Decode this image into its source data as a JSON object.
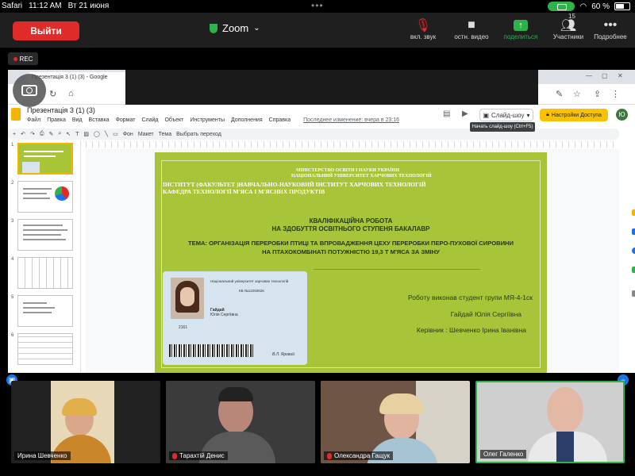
{
  "status_bar": {
    "app": "Safari",
    "time": "11:12 AM",
    "date": "Вт 21 июня",
    "battery": "60 %"
  },
  "zoom": {
    "leave_label": "Выйти",
    "title": "Zoom",
    "controls": [
      {
        "label": "вкл. звук",
        "icon": "mic-muted-icon"
      },
      {
        "label": "остн. видео",
        "icon": "video-icon"
      },
      {
        "label": "поделиться",
        "icon": "share-icon"
      },
      {
        "label": "Участники",
        "icon": "participants-icon",
        "count": "15"
      },
      {
        "label": "Подробнее",
        "icon": "more-icon"
      }
    ],
    "rec_label": "REC"
  },
  "browser": {
    "tab_title": "Презентація 3 (1) (3) - Google"
  },
  "slides_app": {
    "doc_title": "Презентація 3 (1) (3)",
    "menu": [
      "Файл",
      "Правка",
      "Вид",
      "Вставка",
      "Формат",
      "Слайд",
      "Объект",
      "Инструменты",
      "Дополнения",
      "Справка"
    ],
    "last_edit": "Последнее изменение: вчера в 23:16",
    "slideshow_label": "Слайд-шоу",
    "access_label": "Настройки Доступа",
    "avatar_letter": "Ю",
    "tooltip": "Начать слайд-шоу (Ctrl+F5)",
    "toolbar": {
      "background": "Фон",
      "layout": "Макет",
      "theme": "Тема",
      "transition": "Выбрать переход"
    },
    "slide_numbers": [
      "1",
      "2",
      "3",
      "4",
      "5",
      "6"
    ]
  },
  "slide": {
    "ministry_line1": "МІНІСТЕРСТВО ОСВІТИ І НАУКИ УКРАЇНИ",
    "ministry_line2": "НАЦІОНАЛЬНИЙ УНІВЕРСИТЕТ ХАРЧОВИХ ТЕХНОЛОГІЙ",
    "institute": "ІНСТИТУТ (ФАКУЛЬТЕТ )НАВЧАЛЬНО-НАУКОВИЙ ІНСТИТУТ ХАРЧОВИХ ТЕХНОЛОГІЙ",
    "department": "КАФЕДРА ТЕХНОЛОГІЇ М'ЯСА І М'ЯСНИХ ПРОДУКТІВ",
    "work_title": "КВАЛІФІКАЦІЙНА РОБОТА",
    "degree": "НА ЗДОБУТТЯ ОСВІТНЬОГО СТУПЕНЯ БАКАЛАВР",
    "topic_line1": "ТЕМА: ОРГАНІЗАЦІЯ ПЕРЕРОБКИ ПТИЦІ ТА ВПРОВАДЖЕННЯ ЦЕХУ ПЕРЕРОБКИ ПЕРО-ПУХОВОЇ СИРОВИНИ",
    "topic_line2": "НА   ПТАХОКОМБІНАТІ ПОТУЖНІСТЮ 19,3 Т М'ЯСА ЗА ЗМІНУ",
    "author_line": "Роботу виконав студент групи МЯ-4-1ск",
    "author_name": "Гайдай Юлія Сергіївна",
    "supervisor": "Керівник : Шевченко Ірина Іванівна",
    "card": {
      "university": "Національний університет харчових технологій",
      "number": "КВ №12283626",
      "surname": "Гайдай",
      "name": "Юлія Сергіївна",
      "id": "2161",
      "signature": "В.Л. Яровий"
    }
  },
  "participants": [
    {
      "name": "Ирина Шевченко",
      "muted": false
    },
    {
      "name": "Тарахтій Денис",
      "muted": true
    },
    {
      "name": "Олександра Гащук",
      "muted": true
    },
    {
      "name": "Олег Галенко",
      "muted": false
    }
  ],
  "colors": {
    "slide_bg": "#a8c439",
    "leave": "#e02b2b",
    "accent_green": "#2fb24c",
    "access_yellow": "#f9c200"
  }
}
